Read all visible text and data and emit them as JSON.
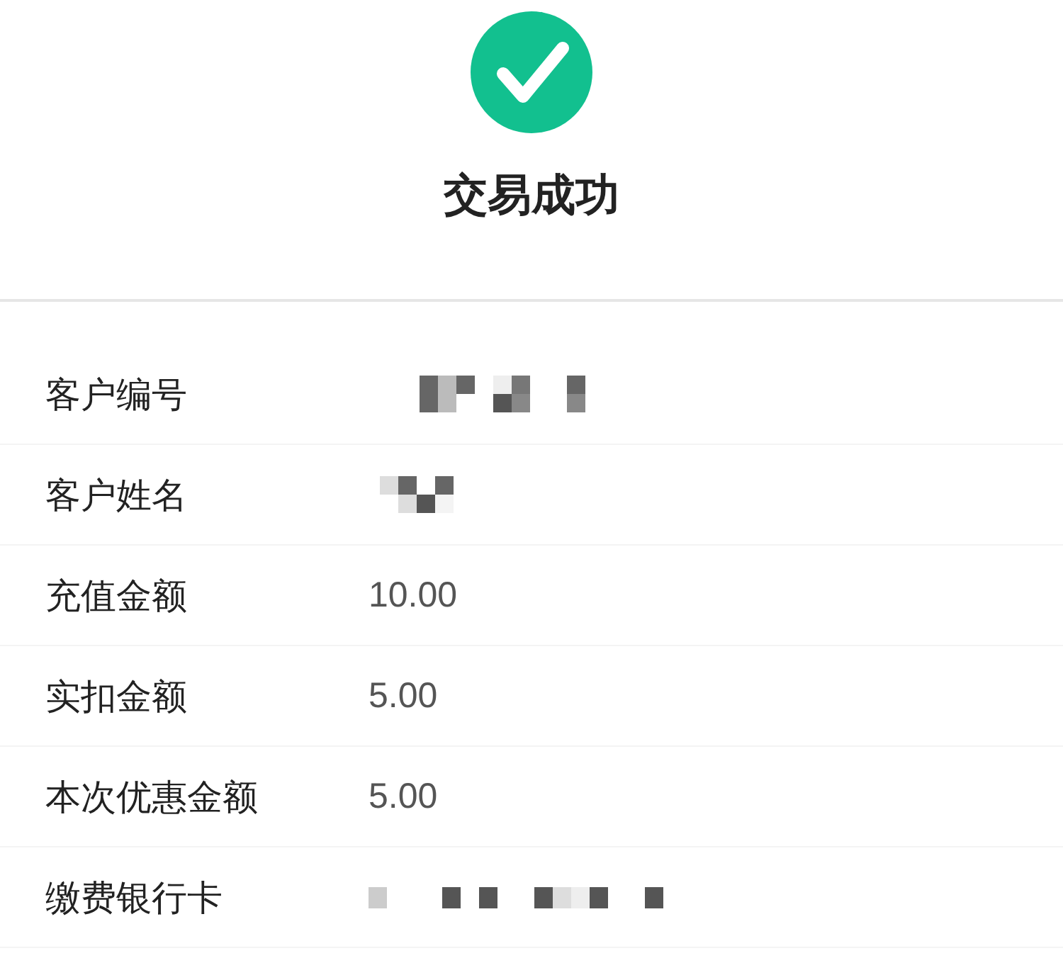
{
  "status": {
    "title": "交易成功"
  },
  "details": [
    {
      "label": "客户编号",
      "kind": "masked"
    },
    {
      "label": "客户姓名",
      "kind": "masked"
    },
    {
      "label": "充值金额",
      "kind": "text",
      "value": "10.00"
    },
    {
      "label": "实扣金额",
      "kind": "text",
      "value": "5.00"
    },
    {
      "label": "本次优惠金额",
      "kind": "text",
      "value": "5.00"
    },
    {
      "label": "缴费银行卡",
      "kind": "masked"
    }
  ]
}
